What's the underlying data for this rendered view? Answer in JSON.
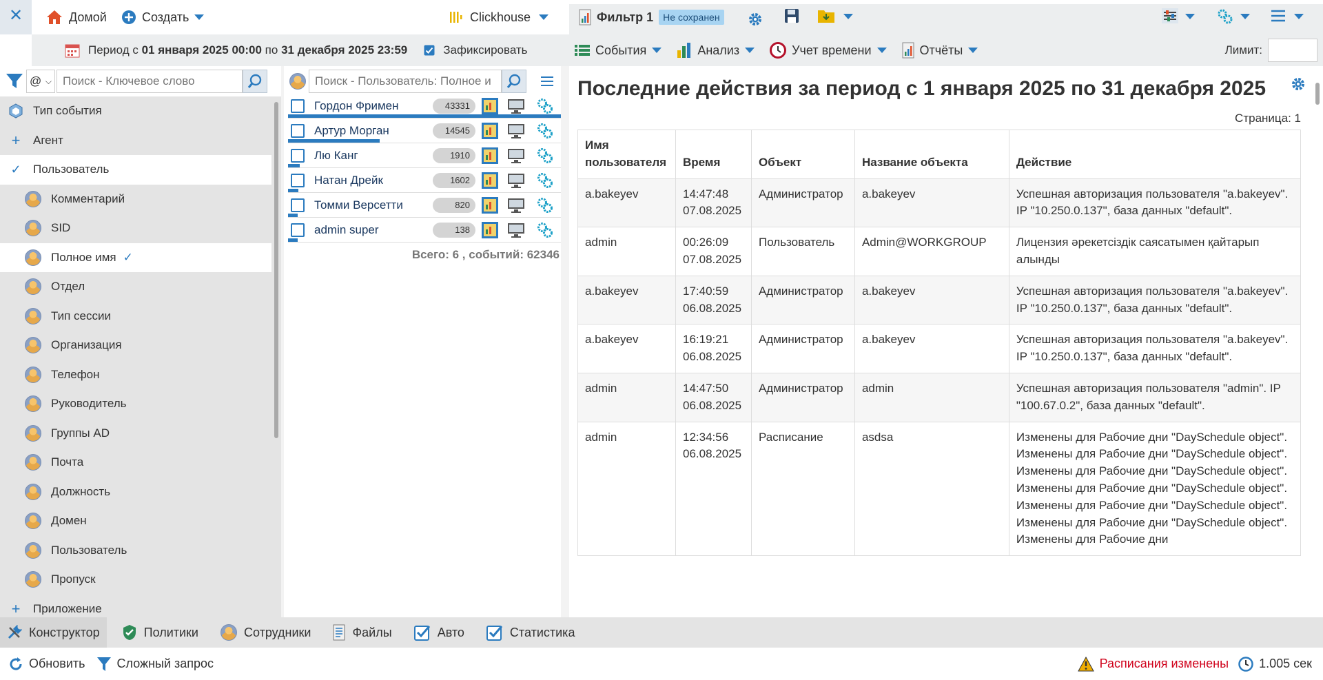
{
  "topbar": {
    "home_label": "Домой",
    "create_label": "Создать",
    "db_label": "Clickhouse",
    "filter_label": "Фильтр 1",
    "unsaved_badge": "Не сохранен"
  },
  "period": {
    "prefix": "Период с",
    "from": "01 января 2025 00:00",
    "middle": "по",
    "to": "31 декабря 2025 23:59",
    "fix_label": "Зафиксировать",
    "fixed": true
  },
  "toolbar2": {
    "events_label": "События",
    "analysis_label": "Анализ",
    "time_label": "Учет времени",
    "reports_label": "Отчёты",
    "limit_label": "Лимит:",
    "limit_value": ""
  },
  "left": {
    "search_prefix": "@",
    "search_placeholder": "Поиск - Ключевое слово",
    "items": [
      {
        "label": "Тип события",
        "kind": "top-icon"
      },
      {
        "label": "Агент",
        "kind": "plus"
      },
      {
        "label": "Пользователь",
        "kind": "check"
      },
      {
        "label": "Комментарий",
        "kind": "person"
      },
      {
        "label": "SID",
        "kind": "person"
      },
      {
        "label": "Полное имя",
        "kind": "person-selected"
      },
      {
        "label": "Отдел",
        "kind": "person"
      },
      {
        "label": "Тип сессии",
        "kind": "person"
      },
      {
        "label": "Организация",
        "kind": "person"
      },
      {
        "label": "Телефон",
        "kind": "person"
      },
      {
        "label": "Руководитель",
        "kind": "person"
      },
      {
        "label": "Группы AD",
        "kind": "person"
      },
      {
        "label": "Почта",
        "kind": "person"
      },
      {
        "label": "Должность",
        "kind": "person"
      },
      {
        "label": "Домен",
        "kind": "person"
      },
      {
        "label": "Пользователь",
        "kind": "person"
      },
      {
        "label": "Пропуск",
        "kind": "person"
      },
      {
        "label": "Приложение",
        "kind": "plus"
      }
    ]
  },
  "middle": {
    "search_placeholder": "Поиск - Пользователь: Полное и",
    "users": [
      {
        "name": "Гордон Фримен",
        "count": "43331",
        "share": 1.0
      },
      {
        "name": "Артур Морган",
        "count": "14545",
        "share": 0.336
      },
      {
        "name": "Лю Канг",
        "count": "1910",
        "share": 0.044
      },
      {
        "name": "Натан Дрейк",
        "count": "1602",
        "share": 0.037
      },
      {
        "name": "Томми Версетти",
        "count": "820",
        "share": 0.019
      },
      {
        "name": "admin super",
        "count": "138",
        "share": 0.003
      }
    ],
    "total": "Всего: 6 , событий: 62346"
  },
  "main": {
    "title": "Последние действия за период с 1 января 2025 по 31 декабря 2025",
    "page": "Страница: 1",
    "columns": [
      "Имя пользователя",
      "Время",
      "Объект",
      "Название объекта",
      "Действие"
    ],
    "rows": [
      {
        "user": "a.bakeyev",
        "time": "14:47:48",
        "date": "07.08.2025",
        "object": "Администратор",
        "object_name": "a.bakeyev",
        "action": "Успешная авторизация пользователя \"a.bakeyev\". IP \"10.250.0.137\", база данных \"default\"."
      },
      {
        "user": "admin",
        "time": "00:26:09",
        "date": "07.08.2025",
        "object": "Пользователь",
        "object_name": "Admin@WORKGROUP",
        "action": "Лицензия әрекетсіздік саясатымен қайтарып алынды"
      },
      {
        "user": "a.bakeyev",
        "time": "17:40:59",
        "date": "06.08.2025",
        "object": "Администратор",
        "object_name": "a.bakeyev",
        "action": "Успешная авторизация пользователя \"a.bakeyev\". IP \"10.250.0.137\", база данных \"default\"."
      },
      {
        "user": "a.bakeyev",
        "time": "16:19:21",
        "date": "06.08.2025",
        "object": "Администратор",
        "object_name": "a.bakeyev",
        "action": "Успешная авторизация пользователя \"a.bakeyev\". IP \"10.250.0.137\", база данных \"default\"."
      },
      {
        "user": "admin",
        "time": "14:47:50",
        "date": "06.08.2025",
        "object": "Администратор",
        "object_name": "admin",
        "action": "Успешная авторизация пользователя \"admin\". IP \"100.67.0.2\", база данных \"default\"."
      },
      {
        "user": "admin",
        "time": "12:34:56",
        "date": "06.08.2025",
        "object": "Расписание",
        "object_name": "asdsa",
        "action": "Изменены  для Рабочие дни \"DaySchedule object\". Изменены  для Рабочие дни \"DaySchedule object\". Изменены  для Рабочие дни \"DaySchedule object\". Изменены  для Рабочие дни \"DaySchedule object\". Изменены для Рабочие дни \"DaySchedule object\". Изменены  для Рабочие дни \"DaySchedule object\". Изменены  для Рабочие дни"
      }
    ]
  },
  "bottom": {
    "tabs": [
      "Конструктор",
      "Политики",
      "Сотрудники",
      "Файлы",
      "Авто",
      "Статистика"
    ],
    "refresh_label": "Обновить",
    "query_label": "Сложный запрос",
    "warning_label": "Расписания изменены",
    "timing": "1.005 сек"
  },
  "colors": {
    "accent": "#2b7bbf",
    "panel_gray": "#e4e4e4",
    "warning_red": "#d0021b"
  }
}
